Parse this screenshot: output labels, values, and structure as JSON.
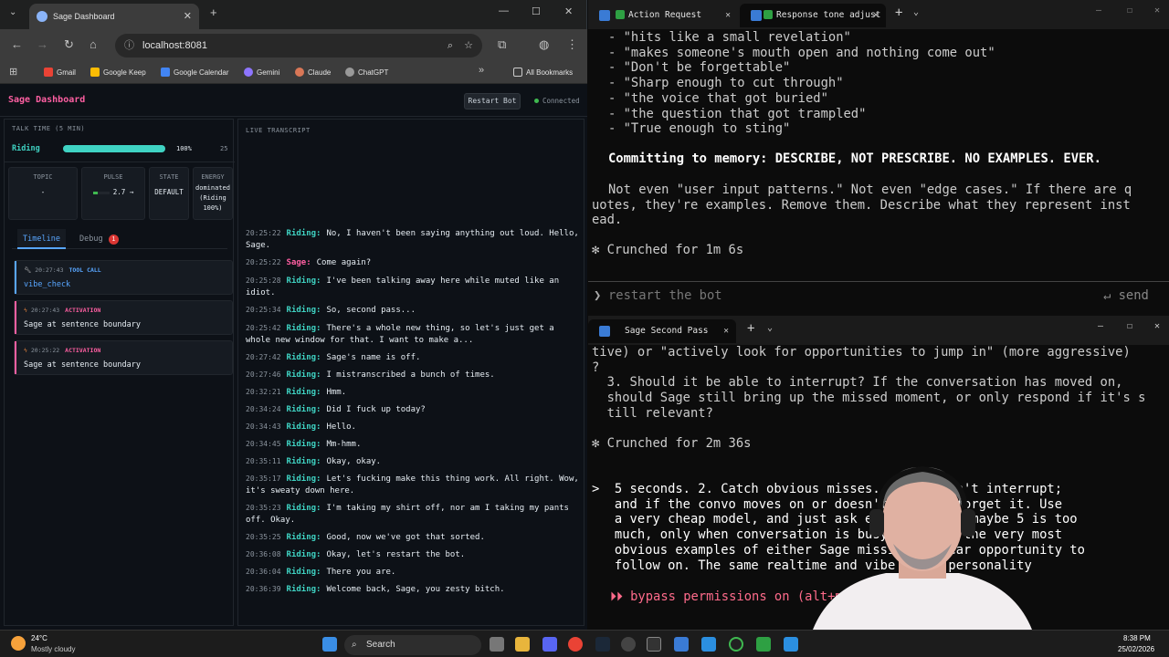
{
  "browser": {
    "tab_title": "Sage Dashboard",
    "url": "localhost:8081",
    "bookmarks": [
      "Gmail",
      "Google Keep",
      "Google Calendar",
      "Gemini",
      "Claude",
      "ChatGPT"
    ],
    "all_bookmarks": "All Bookmarks"
  },
  "dashboard": {
    "title": "Sage Dashboard",
    "restart": "Restart Bot",
    "status": "Connected",
    "talk_label": "TALK TIME (5 MIN)",
    "talk_name": "Riding",
    "talk_pct": "100%",
    "talk_secs": "25",
    "talk_fraction": 1.0,
    "cards": {
      "topic_label": "TOPIC",
      "topic": "-",
      "pulse_label": "PULSE",
      "pulse": "2.7 →",
      "state_label": "STATE",
      "state": "DEFAULT",
      "energy_label": "ENERGY",
      "energy": "dominated (Riding 100%)"
    },
    "tab_timeline": "Timeline",
    "tab_debug": "Debug",
    "debug_count": "1",
    "events": [
      {
        "time": "20:27:43",
        "tag": "TOOL CALL",
        "msg": "vibe_check",
        "color": "#58a6ff"
      },
      {
        "time": "20:27:43",
        "tag": "ACTIVATION",
        "msg": "Sage at sentence boundary",
        "color": "#ff5fa2"
      },
      {
        "time": "20:25:22",
        "tag": "ACTIVATION",
        "msg": "Sage at sentence boundary",
        "color": "#ff5fa2"
      }
    ],
    "transcript_label": "LIVE TRANSCRIPT",
    "transcript": [
      {
        "t": "20:25:22",
        "s": "Riding:",
        "m": "No, I haven't been saying anything out loud. Hello, Sage."
      },
      {
        "t": "20:25:22",
        "s": "Sage:",
        "m": "Come again?"
      },
      {
        "t": "20:25:28",
        "s": "Riding:",
        "m": "I've been talking away here while muted like an idiot."
      },
      {
        "t": "20:25:34",
        "s": "Riding:",
        "m": "So, second pass..."
      },
      {
        "t": "20:25:42",
        "s": "Riding:",
        "m": "There's a whole new thing, so let's just get a whole new window for that. I want to make a..."
      },
      {
        "t": "20:27:42",
        "s": "Riding:",
        "m": "Sage's name is off."
      },
      {
        "t": "20:27:46",
        "s": "Riding:",
        "m": "I mistranscribed a bunch of times."
      },
      {
        "t": "20:32:21",
        "s": "Riding:",
        "m": "Hmm."
      },
      {
        "t": "20:34:24",
        "s": "Riding:",
        "m": "Did I fuck up today?"
      },
      {
        "t": "20:34:43",
        "s": "Riding:",
        "m": "Hello."
      },
      {
        "t": "20:34:45",
        "s": "Riding:",
        "m": "Mm-hmm."
      },
      {
        "t": "20:35:11",
        "s": "Riding:",
        "m": "Okay, okay."
      },
      {
        "t": "20:35:17",
        "s": "Riding:",
        "m": "Let's fucking make this thing work. All right. Wow, it's sweaty down here."
      },
      {
        "t": "20:35:23",
        "s": "Riding:",
        "m": "I'm taking my shirt off, nor am I taking my pants off. Okay."
      },
      {
        "t": "20:35:25",
        "s": "Riding:",
        "m": "Good, now we've got that sorted."
      },
      {
        "t": "20:36:08",
        "s": "Riding:",
        "m": "Okay, let's restart the bot."
      },
      {
        "t": "20:36:04",
        "s": "Riding:",
        "m": "There you are."
      },
      {
        "t": "20:36:39",
        "s": "Riding:",
        "m": "Welcome back, Sage, you zesty bitch."
      }
    ]
  },
  "term1": {
    "tab1": "Action Request",
    "tab2": "Response tone adjust",
    "lines": [
      "- \"hits like a small revelation\"",
      "- \"makes someone's mouth open and nothing come out\"",
      "- \"Don't be forgettable\"",
      "- \"Sharp enough to cut through\"",
      "- \"the voice that got buried\"",
      "- \"the question that got trampled\"",
      "- \"True enough to sting\""
    ],
    "commit": "Committing to memory: DESCRIBE, NOT PRESCRIBE. NO EXAMPLES. EVER.",
    "para": [
      "Not even \"user input patterns.\" Not even \"edge cases.\" If there are q",
      "uotes, they're examples. Remove them. Describe what they represent inst",
      "ead."
    ],
    "crunch": "✻ Crunched for 1m 6s",
    "prompt": "restart the bot",
    "send": "↵ send"
  },
  "term2": {
    "tab": "Sage Second Pass",
    "lines": [
      "tive) or \"actively look for opportunities to jump in\" (more aggressive)",
      "?",
      "  3. Should it be able to interrupt? If the conversation has moved on,",
      "  should Sage still bring up the missed moment, or only respond if it's s",
      "  till relevant?"
    ],
    "crunch": "✻ Crunched for 2m 36s",
    "input": [
      ">  5 seconds. 2. Catch obvious misses. It shouldn't interrupt;",
      "   and if the convo moves on or doesn't, it can forget it. Use",
      "   a very cheap model, and just ask every seconds maybe 5 is too",
      "   much, only when conversation is busy. Only on the very most",
      "   obvious examples of either Sage missing a clear opportunity to",
      "   follow on. The same realtime and vibe check personality"
    ],
    "bypass": "⏵⏵ bypass permissions on (alt+m)"
  },
  "taskbar": {
    "temp": "24°C",
    "weather": "Mostly cloudy",
    "search": "Search",
    "time": "8:38 PM",
    "date": "25/02/2026"
  }
}
